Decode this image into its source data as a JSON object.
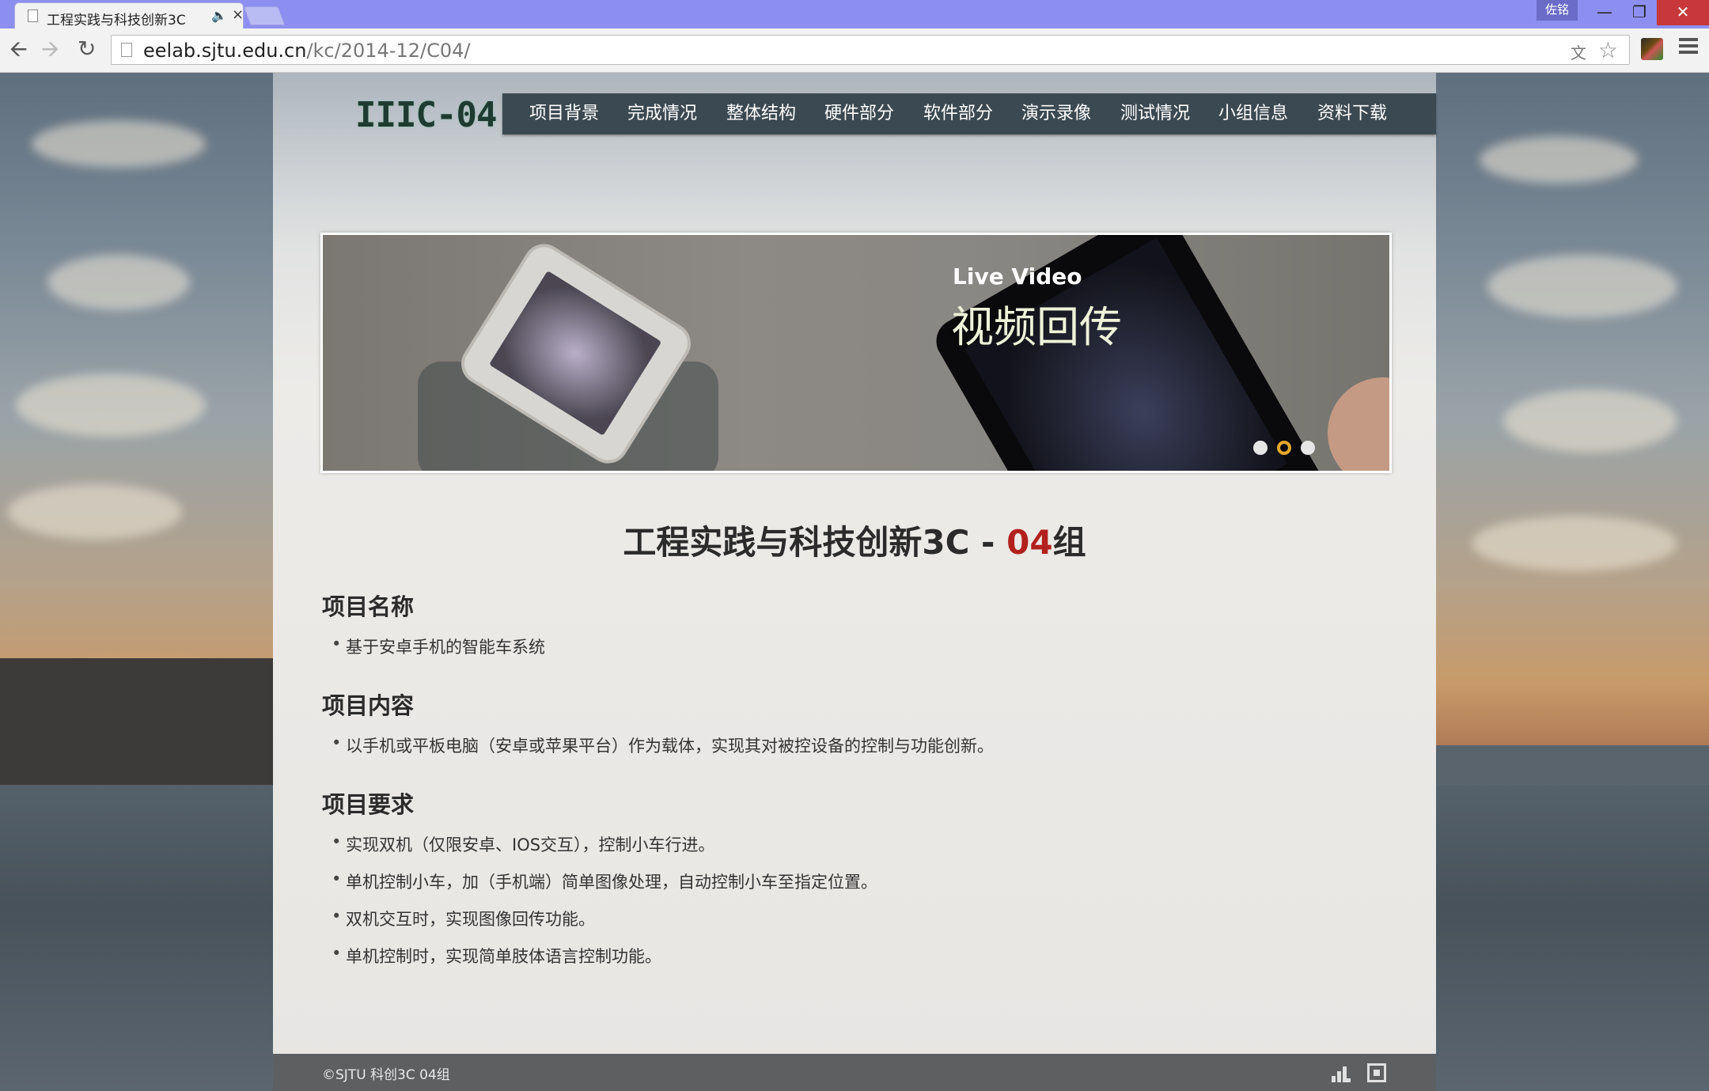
{
  "browser": {
    "tab_title": "工程实践与科技创新3C",
    "url_host": "eelab.sjtu.edu.cn",
    "url_path": "/kc/2014-12/C04/",
    "user_badge": "佐铭",
    "icons": [
      "page-icon",
      "audio-icon",
      "close-icon",
      "back-arrow-icon",
      "forward-arrow-icon",
      "reload-icon",
      "translate-icon",
      "star-icon",
      "extension-icon",
      "menu-icon"
    ]
  },
  "site": {
    "logo": "IIIC-04",
    "nav": [
      "项目背景",
      "完成情况",
      "整体结构",
      "硬件部分",
      "软件部分",
      "演示录像",
      "测试情况",
      "小组信息",
      "资料下载"
    ],
    "banner": {
      "kicker": "Live Video",
      "headline": "视频回传",
      "slides_total": 3,
      "active_slide": 2,
      "active_color": "#e2a92a"
    },
    "title_prefix": "工程实践与科技创新3C - ",
    "title_number": "04",
    "title_suffix": "组",
    "accent_color": "#b3211e",
    "sections": [
      {
        "heading": "项目名称",
        "items": [
          "基于安卓手机的智能车系统"
        ]
      },
      {
        "heading": "项目内容",
        "items": [
          "以手机或平板电脑（安卓或苹果平台）作为载体，实现其对被控设备的控制与功能创新。"
        ]
      },
      {
        "heading": "项目要求",
        "items": [
          "实现双机（仅限安卓、IOS交互），控制小车行进。",
          "单机控制小车，加（手机端）简单图像处理，自动控制小车至指定位置。",
          "双机交互时，实现图像回传功能。",
          "单机控制时，实现简单肢体语言控制功能。"
        ]
      }
    ],
    "footer": "©SJTU 科创3C 04组",
    "footer_icons": [
      "bars-icon",
      "fullscreen-icon"
    ]
  }
}
